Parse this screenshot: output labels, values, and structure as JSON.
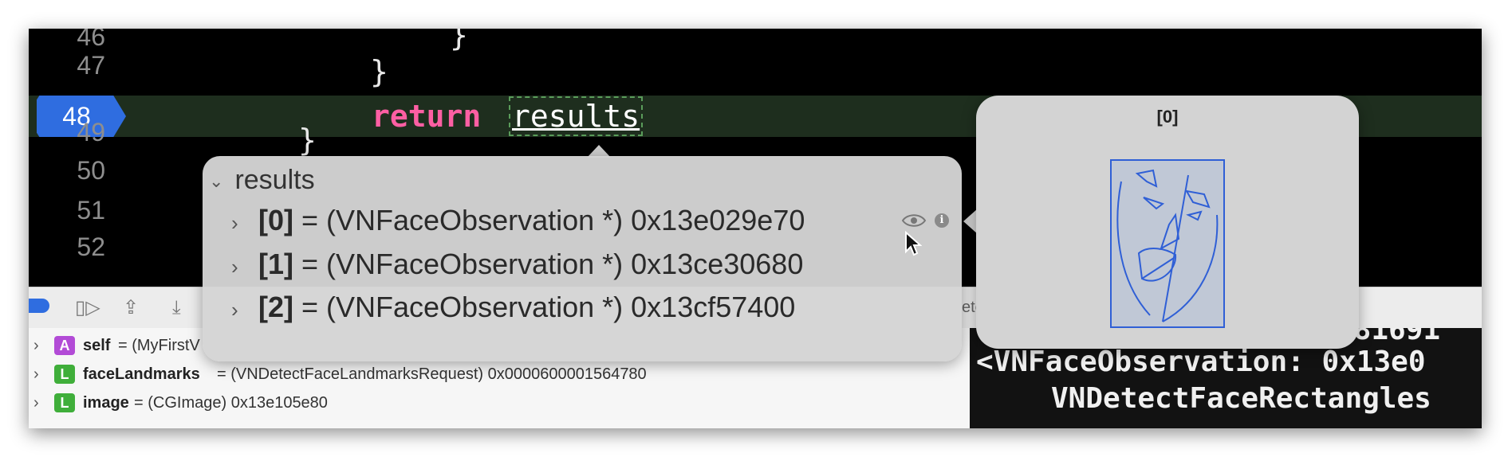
{
  "editor": {
    "line_numbers": [
      "46",
      "47",
      "49",
      "50",
      "51",
      "52"
    ],
    "current_line": "48",
    "code_lines": {
      "l46": "}",
      "l47": "}",
      "l48_keyword": "return",
      "l48_var": "results",
      "l49": "}"
    }
  },
  "debug_toolbar": {
    "partial_text": "ete"
  },
  "popover": {
    "title": "results",
    "items": [
      {
        "index": "[0]",
        "value": " = (VNFaceObservation *) 0x13e029e70"
      },
      {
        "index": "[1]",
        "value": " = (VNFaceObservation *) 0x13ce30680"
      },
      {
        "index": "[2]",
        "value": " = (VNFaceObservation *) 0x13cf57400"
      }
    ]
  },
  "quicklook": {
    "title": "[0]"
  },
  "variables": [
    {
      "badge": "A",
      "name": "self",
      "value": " = (MyFirstV",
      "badge_color": "#b24bd6"
    },
    {
      "badge": "L",
      "name": "faceLandmarks",
      "value": " = (VNDetectFaceLandmarksRequest) 0x0000600001564780",
      "badge_color": "#3fae3a"
    },
    {
      "badge": "L",
      "name": "image",
      "value": " = (CGImage) 0x13e105e80",
      "badge_color": "#3fae3a"
    }
  ],
  "console": {
    "line1": "381691",
    "line2": "<VNFaceObservation: 0x13e0",
    "line3": "VNDetectFaceRectangles"
  },
  "colors": {
    "breakpoint": "#2f6de0",
    "keyword": "#fc5fa3"
  }
}
